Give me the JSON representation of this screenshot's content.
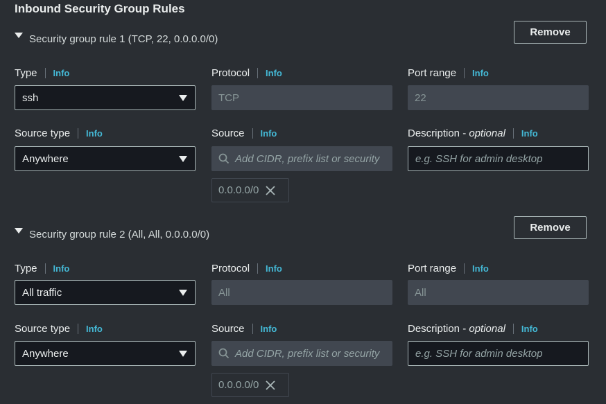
{
  "section_title": "Inbound Security Group Rules",
  "info_label": "Info",
  "remove_label": "Remove",
  "labels": {
    "type": "Type",
    "protocol": "Protocol",
    "port_range": "Port range",
    "source_type": "Source type",
    "source": "Source",
    "description": "Description - ",
    "optional": "optional"
  },
  "source_placeholder": "Add CIDR, prefix list or security",
  "description_placeholder": "e.g. SSH for admin desktop",
  "rules": [
    {
      "title": "Security group rule 1 (TCP, 22, 0.0.0.0/0)",
      "type": "ssh",
      "protocol": "TCP",
      "port_range": "22",
      "source_type": "Anywhere",
      "source_token": "0.0.0.0/0"
    },
    {
      "title": "Security group rule 2 (All, All, 0.0.0.0/0)",
      "type": "All traffic",
      "protocol": "All",
      "port_range": "All",
      "source_type": "Anywhere",
      "source_token": "0.0.0.0/0"
    }
  ],
  "icons": {
    "caret": "caret-down-icon",
    "dropdown": "chevron-down-icon",
    "search": "search-icon",
    "remove_token": "close-icon"
  },
  "colors": {
    "background": "#2a2e33",
    "info_link": "#44b9d6",
    "input_bg": "#16191f",
    "disabled_bg": "#414750"
  }
}
